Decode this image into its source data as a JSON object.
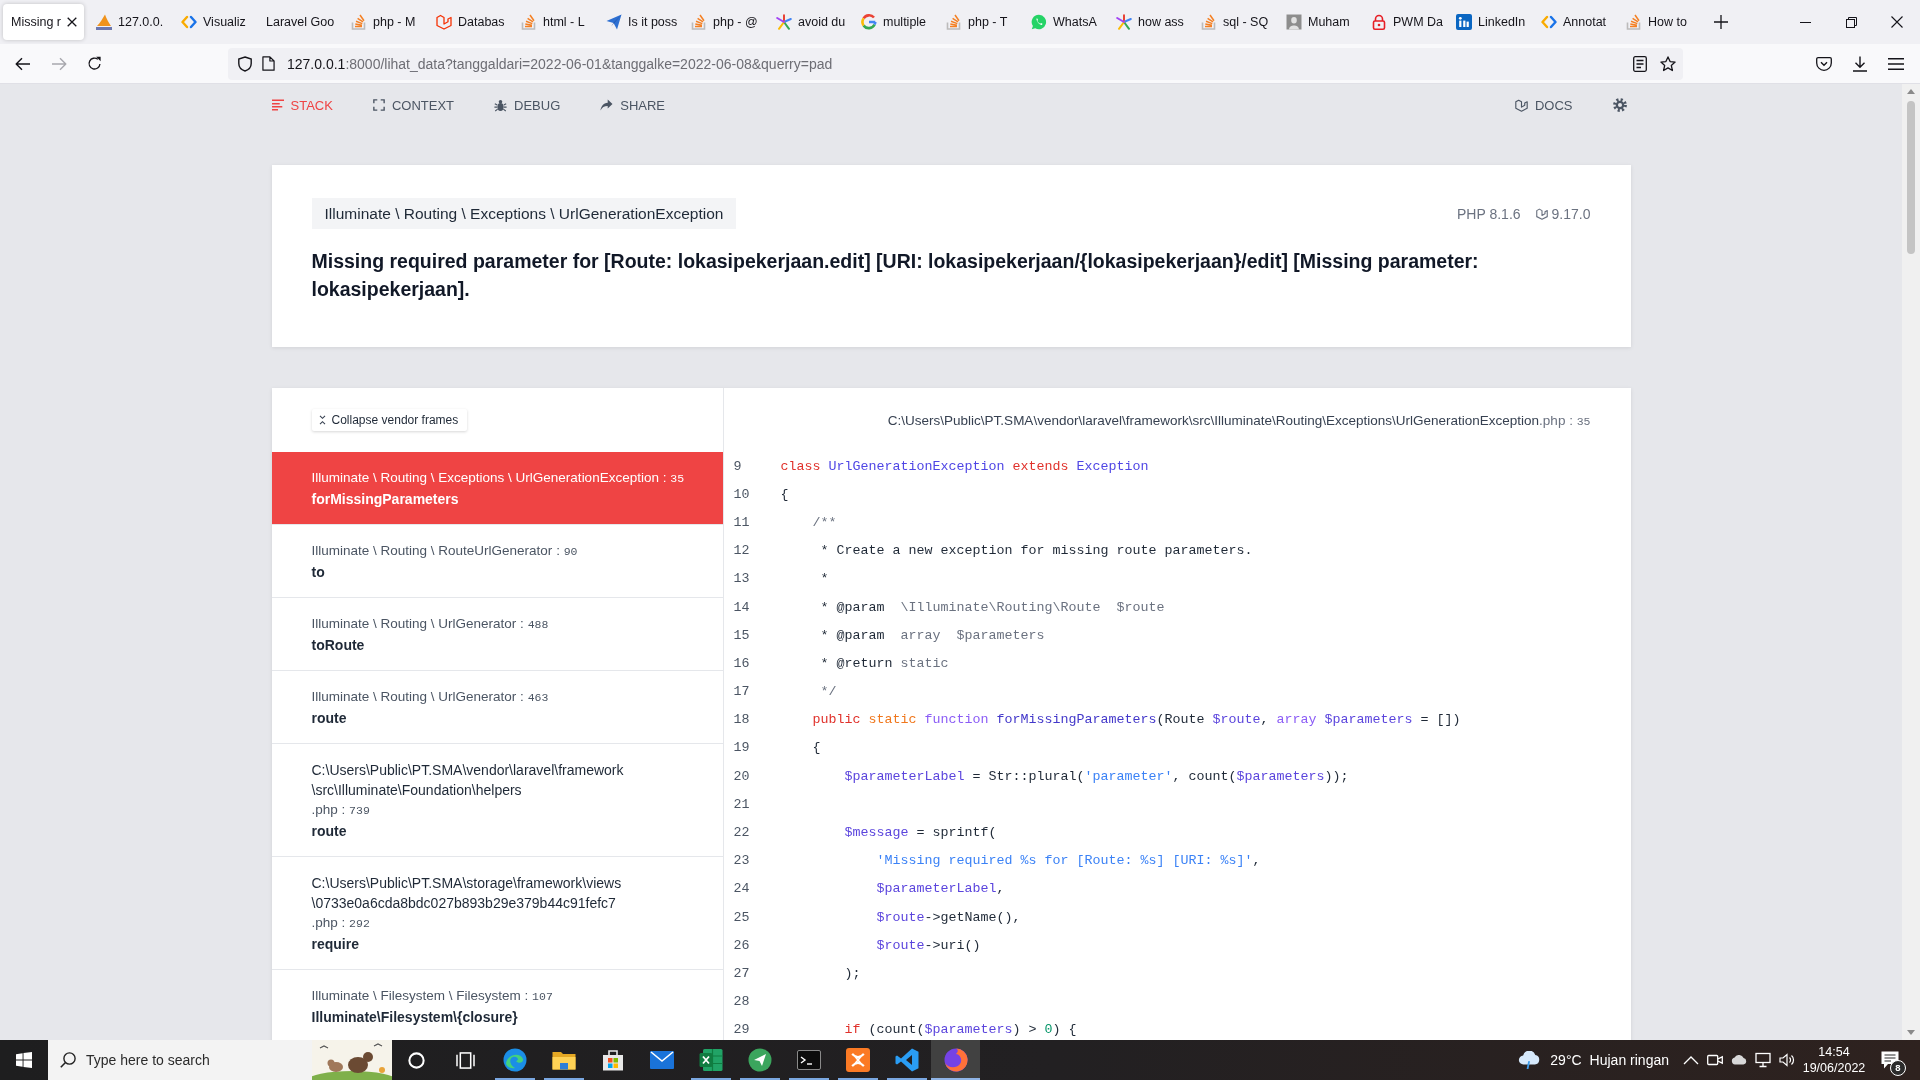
{
  "browser": {
    "tabs": [
      {
        "title": "Missing r",
        "kind": "none",
        "selected": true
      },
      {
        "title": "127.0.0.",
        "kind": "sail",
        "selected": false
      },
      {
        "title": "Visualiz",
        "kind": "brackets",
        "selected": false
      },
      {
        "title": "Laravel Goo",
        "kind": "none",
        "selected": false
      },
      {
        "title": "php - M",
        "kind": "stack",
        "selected": false
      },
      {
        "title": "Databas",
        "kind": "cube",
        "selected": false
      },
      {
        "title": "html - L",
        "kind": "stack",
        "selected": false
      },
      {
        "title": "Is it poss",
        "kind": "plane",
        "selected": false
      },
      {
        "title": "php - @",
        "kind": "stack",
        "selected": false
      },
      {
        "title": "avoid du",
        "kind": "burst",
        "selected": false
      },
      {
        "title": "multiple",
        "kind": "ring",
        "selected": false
      },
      {
        "title": "php - T",
        "kind": "stack",
        "selected": false
      },
      {
        "title": "WhatsA",
        "kind": "chat",
        "selected": false
      },
      {
        "title": "how ass",
        "kind": "burst",
        "selected": false
      },
      {
        "title": "sql - SQ",
        "kind": "stack",
        "selected": false
      },
      {
        "title": "Muham",
        "kind": "thumb",
        "selected": false
      },
      {
        "title": "PWM Da",
        "kind": "lock",
        "selected": false
      },
      {
        "title": "LinkedIn",
        "kind": "square",
        "selected": false
      },
      {
        "title": "Annotat",
        "kind": "brackets",
        "selected": false
      },
      {
        "title": "How to",
        "kind": "stack",
        "selected": false
      }
    ],
    "address": {
      "host": "127.0.0.1",
      "rest": ":8000/lihat_data?tanggaldari=2022-06-01&tanggalke=2022-06-08&querry=pad"
    }
  },
  "nav": {
    "items": [
      {
        "kind": "stack",
        "label": "STACK",
        "selected": true
      },
      {
        "kind": "context",
        "label": "CONTEXT",
        "selected": false
      },
      {
        "kind": "debug",
        "label": "DEBUG",
        "selected": false
      },
      {
        "kind": "share",
        "label": "SHARE",
        "selected": false
      }
    ],
    "docs": "DOCS"
  },
  "error": {
    "exception_class": "Illuminate \\ Routing \\ Exceptions \\ UrlGenerationException",
    "php_version": "PHP 8.1.6",
    "laravel_version": "9.17.0",
    "message": "Missing required parameter for [Route: lokasipekerjaan.edit] [URI: lokasipekerjaan/{lokasipekerjaan}/edit] [Missing parameter: lokasipekerjaan]."
  },
  "stack": {
    "collapse_button": "Collapse vendor frames",
    "frames": [
      {
        "kind": "class",
        "class": "Illuminate \\ Routing \\ Exceptions \\ UrlGenerationException",
        "separator": ":",
        "line": "35",
        "method": "forMissingParameters",
        "selected": true
      },
      {
        "kind": "class",
        "class": "Illuminate \\ Routing \\ RouteUrlGenerator",
        "separator": ":",
        "line": "90",
        "method": "to",
        "selected": false
      },
      {
        "kind": "class",
        "class": "Illuminate \\ Routing \\ UrlGenerator",
        "separator": ":",
        "line": "488",
        "method": "toRoute",
        "selected": false
      },
      {
        "kind": "class",
        "class": "Illuminate \\ Routing \\ UrlGenerator",
        "separator": ":",
        "line": "463",
        "method": "route",
        "selected": false
      },
      {
        "kind": "file",
        "file_lines": [
          "C:\\Users\\Public\\PT.SMA\\vendor\\laravel\\framework",
          "\\src\\Illuminate\\Foundation\\helpers"
        ],
        "extension": ".php",
        "separator": ":",
        "line": "739",
        "method": "route",
        "selected": false
      },
      {
        "kind": "file",
        "file_lines": [
          "C:\\Users\\Public\\PT.SMA\\storage\\framework\\views",
          "\\0733e0a6cda8bdc027b893b29e379b44c91fefc7"
        ],
        "extension": ".php",
        "separator": ":",
        "line": "292",
        "method": "require",
        "selected": false
      },
      {
        "kind": "class",
        "class": "Illuminate \\ Filesystem \\ Filesystem",
        "separator": ":",
        "line": "107",
        "method": "Illuminate\\Filesystem\\{closure}",
        "selected": false
      }
    ]
  },
  "code": {
    "file": "C:\\Users\\Public\\PT.SMA\\vendor\\laravel\\framework\\src\\Illuminate\\Routing\\Exceptions\\UrlGenerationException",
    "extension": ".php",
    "separator": ":",
    "line": "35",
    "lines": [
      {
        "number": "9",
        "tokens": [
          {
            "kind": "keyword",
            "text": "class "
          },
          {
            "kind": "class",
            "text": "UrlGenerationException "
          },
          {
            "kind": "keyword",
            "text": "extends "
          },
          {
            "kind": "class",
            "text": "Exception"
          }
        ]
      },
      {
        "number": "10",
        "tokens": [
          {
            "kind": "plain",
            "text": "{"
          }
        ]
      },
      {
        "number": "11",
        "tokens": [
          {
            "kind": "comment",
            "text": "    /**"
          }
        ]
      },
      {
        "number": "12",
        "tokens": [
          {
            "kind": "plain",
            "text": "     * Create a new exception for missing route parameters."
          }
        ]
      },
      {
        "number": "13",
        "tokens": [
          {
            "kind": "plain",
            "text": "     *"
          }
        ]
      },
      {
        "number": "14",
        "tokens": [
          {
            "kind": "plain",
            "text": "     * @param  "
          },
          {
            "kind": "comment",
            "text": "\\Illuminate\\Routing\\Route  $route"
          }
        ]
      },
      {
        "number": "15",
        "tokens": [
          {
            "kind": "plain",
            "text": "     * @param  "
          },
          {
            "kind": "comment",
            "text": "array  $parameters"
          }
        ]
      },
      {
        "number": "16",
        "tokens": [
          {
            "kind": "plain",
            "text": "     * @return "
          },
          {
            "kind": "comment",
            "text": "static"
          }
        ]
      },
      {
        "number": "17",
        "tokens": [
          {
            "kind": "comment",
            "text": "     */"
          }
        ]
      },
      {
        "number": "18",
        "tokens": [
          {
            "kind": "keyword",
            "text": "    public "
          },
          {
            "kind": "storage",
            "text": "static "
          },
          {
            "kind": "declare",
            "text": "function "
          },
          {
            "kind": "name",
            "text": "forMissingParameters"
          },
          {
            "kind": "plain",
            "text": "(Route "
          },
          {
            "kind": "variable",
            "text": "$route"
          },
          {
            "kind": "plain",
            "text": ", "
          },
          {
            "kind": "type",
            "text": "array "
          },
          {
            "kind": "variable",
            "text": "$parameters"
          },
          {
            "kind": "plain",
            "text": " = [])"
          }
        ]
      },
      {
        "number": "19",
        "tokens": [
          {
            "kind": "plain",
            "text": "    {"
          }
        ]
      },
      {
        "number": "20",
        "tokens": [
          {
            "kind": "variable",
            "text": "        $parameterLabel"
          },
          {
            "kind": "plain",
            "text": " = Str::plural("
          },
          {
            "kind": "string",
            "text": "'parameter'"
          },
          {
            "kind": "plain",
            "text": ", count("
          },
          {
            "kind": "variable",
            "text": "$parameters"
          },
          {
            "kind": "plain",
            "text": "));"
          }
        ]
      },
      {
        "number": "21"
      },
      {
        "number": "22",
        "tokens": [
          {
            "kind": "variable",
            "text": "        $message"
          },
          {
            "kind": "plain",
            "text": " = sprintf("
          }
        ]
      },
      {
        "number": "23",
        "tokens": [
          {
            "kind": "string",
            "text": "            'Missing required %s for [Route: %s] [URI: %s]'"
          },
          {
            "kind": "plain",
            "text": ","
          }
        ]
      },
      {
        "number": "24",
        "tokens": [
          {
            "kind": "variable",
            "text": "            $parameterLabel"
          },
          {
            "kind": "plain",
            "text": ","
          }
        ]
      },
      {
        "number": "25",
        "tokens": [
          {
            "kind": "variable",
            "text": "            $route"
          },
          {
            "kind": "plain",
            "text": "->getName(),"
          }
        ]
      },
      {
        "number": "26",
        "tokens": [
          {
            "kind": "variable",
            "text": "            $route"
          },
          {
            "kind": "plain",
            "text": "->uri()"
          }
        ]
      },
      {
        "number": "27",
        "tokens": [
          {
            "kind": "plain",
            "text": "        );"
          }
        ]
      },
      {
        "number": "28"
      },
      {
        "number": "29",
        "tokens": [
          {
            "kind": "keyword",
            "text": "        if"
          },
          {
            "kind": "plain",
            "text": " (count("
          },
          {
            "kind": "variable",
            "text": "$parameters"
          },
          {
            "kind": "plain",
            "text": ") > "
          },
          {
            "kind": "number",
            "text": "0"
          },
          {
            "kind": "plain",
            "text": ") {"
          }
        ]
      }
    ]
  },
  "taskbar": {
    "search": {
      "placeholder": "Type here to search"
    },
    "buttons": [
      {
        "kind": "ring",
        "running": false,
        "active": false
      },
      {
        "kind": "task-view",
        "running": false,
        "active": false
      },
      {
        "kind": "wave",
        "running": true,
        "active": false
      },
      {
        "kind": "folder",
        "running": true,
        "active": false
      },
      {
        "kind": "bag",
        "running": false,
        "active": false
      },
      {
        "kind": "mail",
        "running": false,
        "active": false
      },
      {
        "kind": "sheet",
        "running": true,
        "active": false
      },
      {
        "kind": "plane",
        "running": true,
        "active": false
      },
      {
        "kind": "terminal",
        "running": true,
        "active": false
      },
      {
        "kind": "tile",
        "running": true,
        "active": false
      },
      {
        "kind": "ribbon",
        "running": true,
        "active": false
      },
      {
        "kind": "globe",
        "running": true,
        "active": true
      }
    ],
    "weather": {
      "temperature": "29°C",
      "condition": "Hujan ringan"
    },
    "clock": {
      "time": "14:54",
      "date": "19/06/2022"
    },
    "notification_count": "8"
  }
}
